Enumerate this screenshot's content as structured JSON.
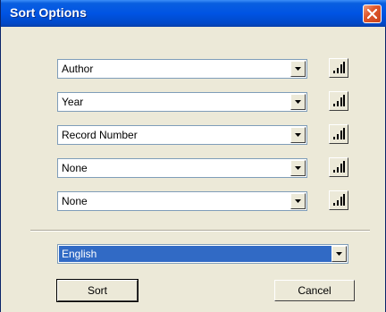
{
  "window": {
    "title": "Sort Options"
  },
  "sort_fields": [
    {
      "value": "Author"
    },
    {
      "value": "Year"
    },
    {
      "value": "Record Number"
    },
    {
      "value": "None"
    },
    {
      "value": "None"
    }
  ],
  "icons": {
    "close": "close-icon",
    "dropdown": "chevron-down-icon",
    "sort_order": "sort-order-icon"
  },
  "language": {
    "value": "English"
  },
  "buttons": {
    "sort": "Sort",
    "cancel": "Cancel"
  },
  "colors": {
    "titlebar": "#0054e3",
    "selection": "#316ac5",
    "close": "#e0572c"
  }
}
